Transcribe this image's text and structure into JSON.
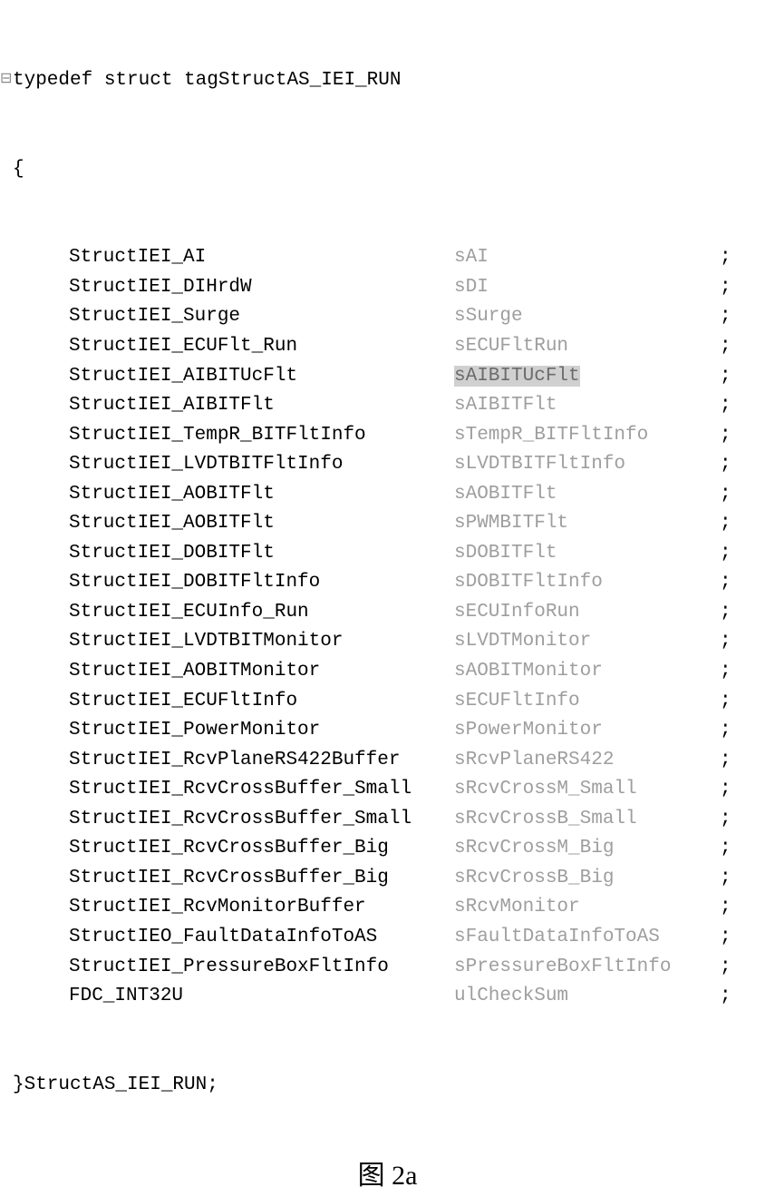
{
  "struct": {
    "typedef_line": "typedef struct tagStructAS_IEI_RUN",
    "open_brace": "{",
    "close_line": "}StructAS_IEI_RUN;",
    "fields": [
      {
        "type": "StructIEI_AI",
        "name": "sAI",
        "highlighted": false
      },
      {
        "type": "StructIEI_DIHrdW",
        "name": "sDI",
        "highlighted": false
      },
      {
        "type": "StructIEI_Surge",
        "name": "sSurge",
        "highlighted": false
      },
      {
        "type": "StructIEI_ECUFlt_Run",
        "name": "sECUFltRun",
        "highlighted": false
      },
      {
        "type": "StructIEI_AIBITUcFlt",
        "name": "sAIBITUcFlt",
        "highlighted": true
      },
      {
        "type": "StructIEI_AIBITFlt",
        "name": "sAIBITFlt",
        "highlighted": false
      },
      {
        "type": "StructIEI_TempR_BITFltInfo",
        "name": "sTempR_BITFltInfo",
        "highlighted": false
      },
      {
        "type": "StructIEI_LVDTBITFltInfo",
        "name": "sLVDTBITFltInfo",
        "highlighted": false
      },
      {
        "type": "StructIEI_AOBITFlt",
        "name": "sAOBITFlt",
        "highlighted": false
      },
      {
        "type": "StructIEI_AOBITFlt",
        "name": "sPWMBITFlt",
        "highlighted": false
      },
      {
        "type": "StructIEI_DOBITFlt",
        "name": "sDOBITFlt",
        "highlighted": false
      },
      {
        "type": "StructIEI_DOBITFltInfo",
        "name": "sDOBITFltInfo",
        "highlighted": false
      },
      {
        "type": "StructIEI_ECUInfo_Run",
        "name": "sECUInfoRun",
        "highlighted": false
      },
      {
        "type": "StructIEI_LVDTBITMonitor",
        "name": "sLVDTMonitor",
        "highlighted": false
      },
      {
        "type": "StructIEI_AOBITMonitor",
        "name": "sAOBITMonitor",
        "highlighted": false
      },
      {
        "type": "StructIEI_ECUFltInfo",
        "name": "sECUFltInfo",
        "highlighted": false
      },
      {
        "type": "StructIEI_PowerMonitor",
        "name": "sPowerMonitor",
        "highlighted": false
      },
      {
        "type": "StructIEI_RcvPlaneRS422Buffer",
        "name": "sRcvPlaneRS422",
        "highlighted": false
      },
      {
        "type": "StructIEI_RcvCrossBuffer_Small",
        "name": "sRcvCrossM_Small",
        "highlighted": false
      },
      {
        "type": "StructIEI_RcvCrossBuffer_Small",
        "name": "sRcvCrossB_Small",
        "highlighted": false
      },
      {
        "type": "StructIEI_RcvCrossBuffer_Big",
        "name": "sRcvCrossM_Big",
        "highlighted": false
      },
      {
        "type": "StructIEI_RcvCrossBuffer_Big",
        "name": "sRcvCrossB_Big",
        "highlighted": false
      },
      {
        "type": "StructIEI_RcvMonitorBuffer",
        "name": "sRcvMonitor",
        "highlighted": false
      },
      {
        "type": "StructIEO_FaultDataInfoToAS",
        "name": "sFaultDataInfoToAS",
        "highlighted": false
      },
      {
        "type": "StructIEI_PressureBoxFltInfo",
        "name": "sPressureBoxFltInfo",
        "highlighted": false
      },
      {
        "type": "FDC_INT32U",
        "name": "ulCheckSum",
        "highlighted": false
      }
    ]
  },
  "caption": "图 2a",
  "collapse_marker": "⊟"
}
